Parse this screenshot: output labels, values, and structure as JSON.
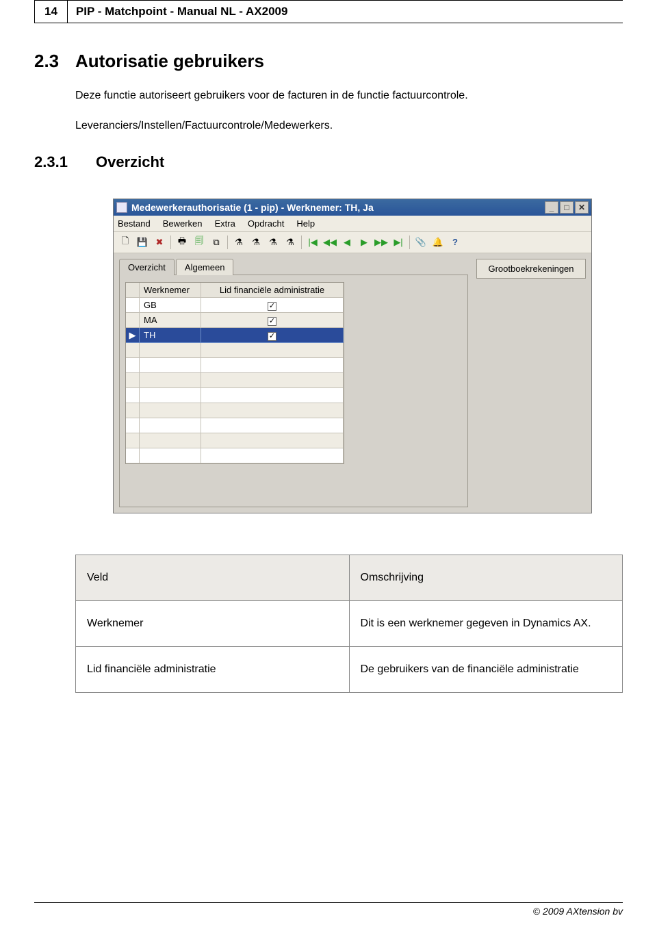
{
  "header": {
    "page_number": "14",
    "title": "PIP - Matchpoint - Manual NL - AX2009"
  },
  "section": {
    "number": "2.3",
    "title": "Autorisatie gebruikers"
  },
  "intro_text": "Deze functie autoriseert gebruikers voor de facturen in de functie factuurcontrole.",
  "path_text": "Leveranciers/Instellen/Factuurcontrole/Medewerkers.",
  "subsection": {
    "number": "2.3.1",
    "title": "Overzicht"
  },
  "window": {
    "title": "Medewerkerauthorisatie (1 - pip) - Werknemer: TH, Ja",
    "menus": [
      "Bestand",
      "Bewerken",
      "Extra",
      "Opdracht",
      "Help"
    ],
    "toolbar_icons": [
      "new-icon",
      "save-icon",
      "delete-icon",
      "sep",
      "print-icon",
      "preview-icon",
      "excel-icon",
      "sep",
      "filter-icon",
      "filter-by-icon",
      "filter-clear-icon",
      "filter-adv-icon",
      "sep",
      "first-icon",
      "prev-page-icon",
      "prev-icon",
      "next-icon",
      "next-page-icon",
      "last-icon",
      "sep",
      "attach-icon",
      "alert-icon",
      "help-icon"
    ],
    "toolbar_glyphs": {
      "new-icon": "🗋",
      "save-icon": "💾",
      "delete-icon": "✖",
      "print-icon": "🖶",
      "preview-icon": "🗐",
      "excel-icon": "⧉",
      "filter-icon": "⚗",
      "filter-by-icon": "⚗",
      "filter-clear-icon": "⚗",
      "filter-adv-icon": "⚗",
      "first-icon": "|◀",
      "prev-page-icon": "◀◀",
      "prev-icon": "◀",
      "next-icon": "▶",
      "next-page-icon": "▶▶",
      "last-icon": "▶|",
      "attach-icon": "📎",
      "alert-icon": "🔔",
      "help-icon": "?"
    },
    "tabs": [
      {
        "label": "Overzicht",
        "active": true
      },
      {
        "label": "Algemeen",
        "active": false
      }
    ],
    "side_button": "Grootboekrekeningen",
    "grid": {
      "columns": [
        "Werknemer",
        "Lid financiële administratie"
      ],
      "rows": [
        {
          "werknemer": "GB",
          "lid": true,
          "selected": false
        },
        {
          "werknemer": "MA",
          "lid": true,
          "selected": false
        },
        {
          "werknemer": "TH",
          "lid": true,
          "selected": true
        }
      ],
      "empty_rows": 8
    }
  },
  "table": {
    "head": {
      "col1": "Veld",
      "col2": "Omschrijving"
    },
    "rows": [
      {
        "col1": "Werknemer",
        "col2": "Dit is een werknemer gegeven in Dynamics AX."
      },
      {
        "col1": "Lid financiële administratie",
        "col2": "De gebruikers van de financiële administratie"
      }
    ]
  },
  "footer": "© 2009 AXtension bv"
}
